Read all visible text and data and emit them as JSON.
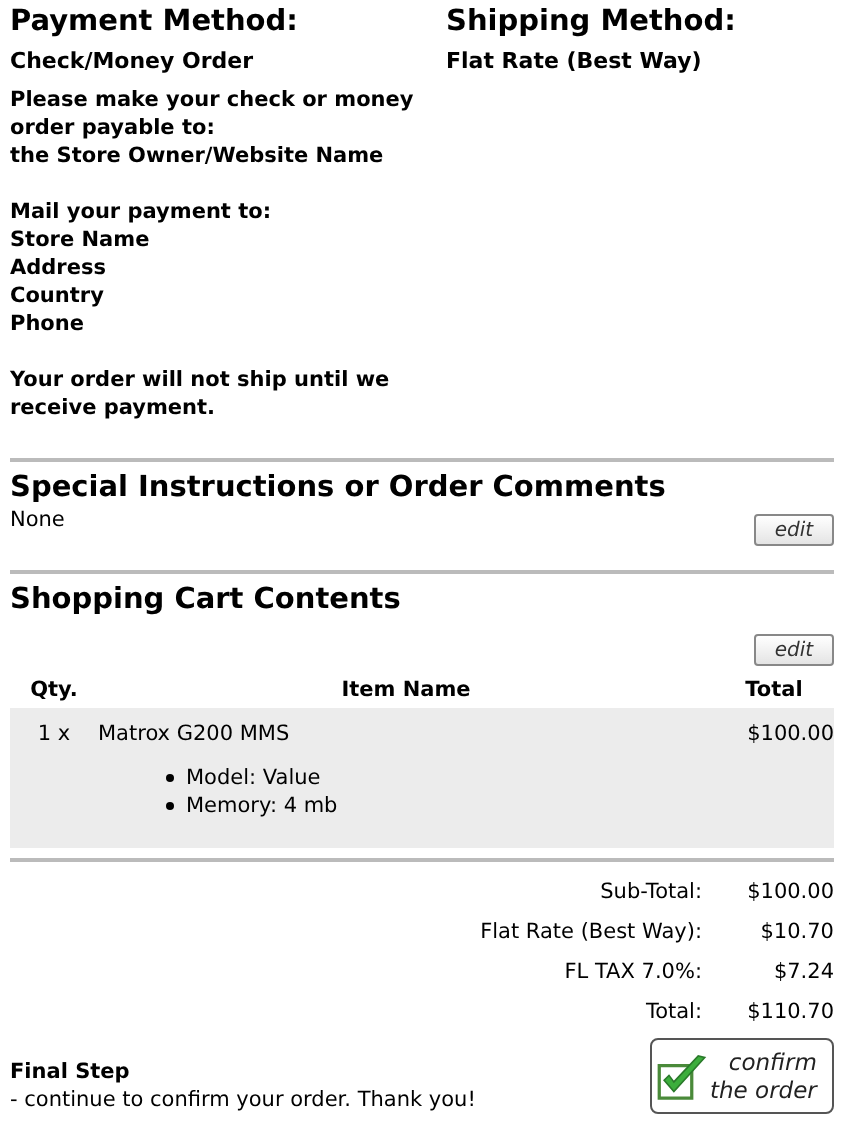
{
  "payment": {
    "heading": "Payment Method:",
    "method": "Check/Money Order",
    "instructions": "Please make your check or money\norder payable to:\nthe Store Owner/Website Name",
    "mail_label": "Mail your payment to:",
    "address": [
      "Store Name",
      "Address",
      "Country",
      "Phone"
    ],
    "notice": "Your order will not ship until we\nreceive payment."
  },
  "shipping": {
    "heading": "Shipping Method:",
    "method": "Flat Rate (Best Way)"
  },
  "comments": {
    "heading": "Special Instructions or Order Comments",
    "text": "None",
    "edit_button": "edit"
  },
  "cart": {
    "heading": "Shopping Cart Contents",
    "edit_button": "edit",
    "columns": [
      "Qty.",
      "Item Name",
      "Total"
    ],
    "rows": [
      {
        "qty": "1 x",
        "name": "Matrox G200 MMS",
        "total": "$100.00",
        "attributes": [
          "Model: Value",
          "Memory: 4 mb"
        ]
      }
    ]
  },
  "totals": [
    {
      "label": "Sub-Total:",
      "value": "$100.00"
    },
    {
      "label": "Flat Rate (Best Way):",
      "value": "$10.70"
    },
    {
      "label": "FL TAX 7.0%:",
      "value": "$7.24"
    },
    {
      "label": "Total:",
      "value": "$110.70"
    }
  ],
  "final": {
    "heading": "Final Step",
    "text": "- continue to confirm your order. Thank you!",
    "confirm_button": "confirm\nthe order"
  }
}
